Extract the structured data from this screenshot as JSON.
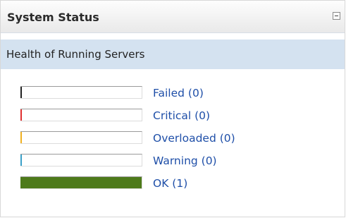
{
  "panel": {
    "title": "System Status",
    "collapse_icon": "minus-box-icon"
  },
  "subheader": {
    "text": "Health of Running Servers"
  },
  "health": [
    {
      "label": "Failed (0)",
      "count": 0,
      "color": "#222222"
    },
    {
      "label": "Critical (0)",
      "count": 0,
      "color": "#e03030"
    },
    {
      "label": "Overloaded (0)",
      "count": 0,
      "color": "#f0b020"
    },
    {
      "label": "Warning (0)",
      "count": 0,
      "color": "#3aa0c8"
    },
    {
      "label": "OK (1)",
      "count": 1,
      "color": "#4d7a1a"
    }
  ]
}
